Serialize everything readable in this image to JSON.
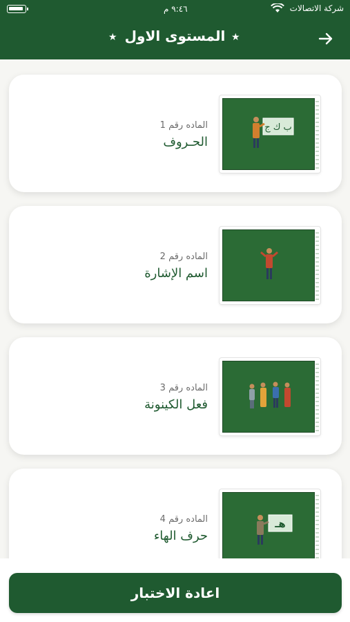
{
  "status_bar": {
    "carrier": "شركة الاتصالات",
    "time": "٩:٤٦ م"
  },
  "header": {
    "title": "المستوى الاول",
    "star": "★"
  },
  "lessons": [
    {
      "number_label": "الماده رقم 1",
      "title": "الحـروف",
      "board_text": "ب ك ج"
    },
    {
      "number_label": "الماده رقم 2",
      "title": "اسم الإشارة"
    },
    {
      "number_label": "الماده رقم 3",
      "title": "فعل الكينونة"
    },
    {
      "number_label": "الماده رقم 4",
      "title": "حرف الهاء",
      "board_text": "هـ"
    }
  ],
  "footer": {
    "retake_label": "اعادة الاختبار"
  },
  "colors": {
    "primary": "#1f5a30",
    "board": "#2b6b35",
    "background": "#f6f6f3"
  }
}
